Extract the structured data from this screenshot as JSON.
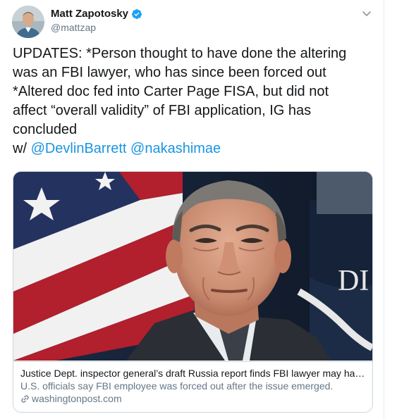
{
  "author": {
    "display_name": "Matt Zapotosky",
    "handle": "@mattzap",
    "verified": true,
    "avatar_icon": "user-avatar"
  },
  "tweet": {
    "line1": "UPDATES: *Person thought to have done the altering",
    "line2": "was an FBI lawyer, who has since been forced out",
    "line3": "*Altered doc fed into Carter Page FISA, but did not",
    "line4": "affect “overall validity” of FBI application, IG has",
    "line5": "concluded",
    "with_prefix": "w/ ",
    "mention1": "@DevlinBarrett",
    "mention2": "@nakashimae"
  },
  "card": {
    "image_text": "DI",
    "title": "Justice Dept. inspector general’s draft Russia report finds FBI lawyer may have altered a document in Carter Page FISA application",
    "description": "U.S. officials say FBI employee was forced out after the issue emerged.",
    "domain": "washingtonpost.com"
  },
  "colors": {
    "link": "#1b95e0",
    "verified": "#1da1f2",
    "secondary_text": "#657786",
    "border": "#ccd6dd"
  }
}
